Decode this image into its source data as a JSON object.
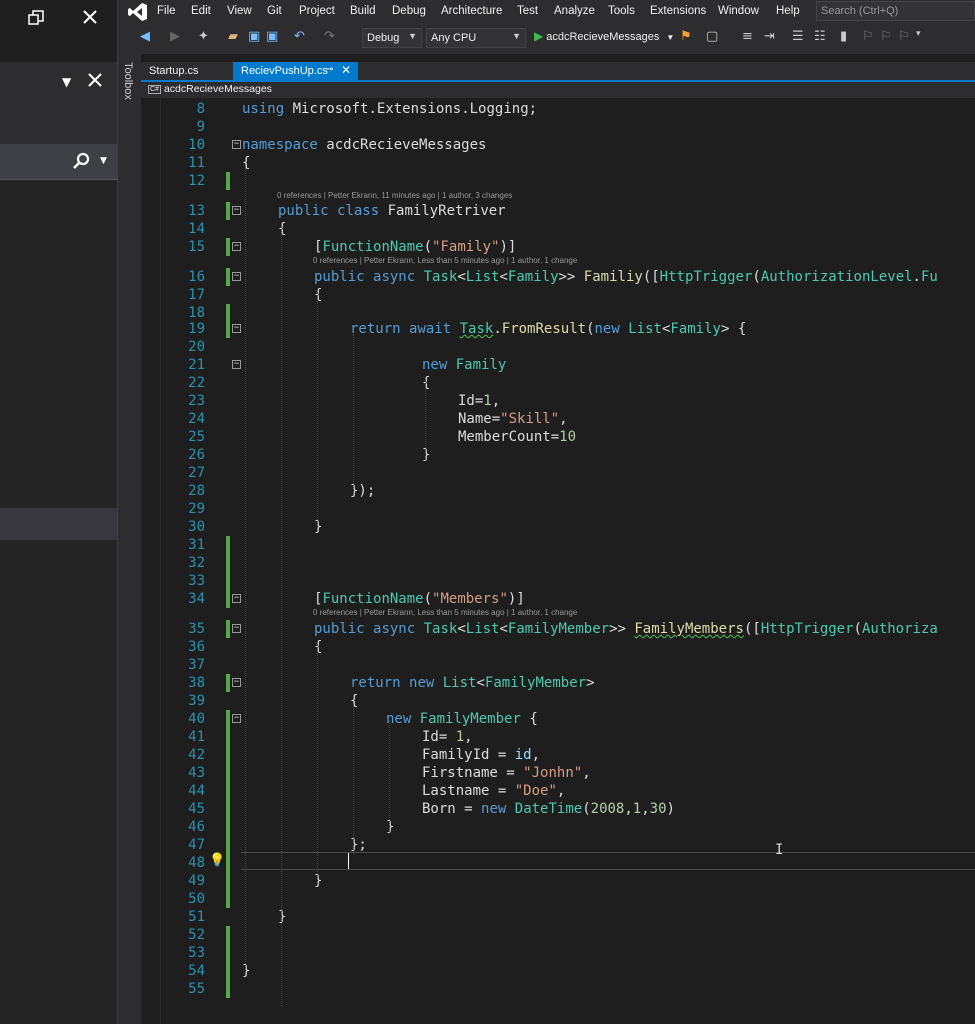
{
  "menu": {
    "items": [
      "File",
      "Edit",
      "View",
      "Git",
      "Project",
      "Build",
      "Debug",
      "Architecture",
      "Test",
      "Analyze",
      "Tools",
      "Extensions",
      "Window",
      "Help"
    ],
    "search_placeholder": "Search (Ctrl+Q)"
  },
  "toolbar": {
    "config": "Debug",
    "platform": "Any CPU",
    "run_target": "acdcRecieveMessages"
  },
  "toolbox_label": "Toolbox",
  "tabs": [
    {
      "label": "Startup.cs",
      "active": false
    },
    {
      "label": "RecievPushUp.cs",
      "active": true
    }
  ],
  "navbar": {
    "project": "acdcRecieveMessages"
  },
  "code_lens": {
    "class": "0 references | Petter Ekrann, 11 minutes ago | 1 author, 3 changes",
    "familiy": "0 references | Petter Ekrann, Less than 5 minutes ago | 1 author, 1 change",
    "members": "0 references | Petter Ekrann, Less than 5 minutes ago | 1 author, 1 change"
  },
  "code_lines": [
    {
      "n": "8",
      "code": "using Microsoft.Extensions.Logging;"
    },
    {
      "n": "9",
      "code": ""
    },
    {
      "n": "10",
      "code": "namespace acdcRecieveMessages"
    },
    {
      "n": "11",
      "code": "{"
    },
    {
      "n": "12",
      "code": ""
    },
    {
      "n": "13",
      "code": "public class FamilyRetriver"
    },
    {
      "n": "14",
      "code": "{"
    },
    {
      "n": "15",
      "code": "[FunctionName(\"Family\")]"
    },
    {
      "n": "16",
      "code": "public async Task<List<Family>> Familiy([HttpTrigger(AuthorizationLevel.Fu"
    },
    {
      "n": "17",
      "code": "{"
    },
    {
      "n": "18",
      "code": ""
    },
    {
      "n": "19",
      "code": "return await Task.FromResult(new List<Family> {"
    },
    {
      "n": "20",
      "code": ""
    },
    {
      "n": "21",
      "code": "new Family"
    },
    {
      "n": "22",
      "code": "{"
    },
    {
      "n": "23",
      "code": "Id=1,"
    },
    {
      "n": "24",
      "code": "Name=\"Skill\","
    },
    {
      "n": "25",
      "code": "MemberCount=10"
    },
    {
      "n": "26",
      "code": "}"
    },
    {
      "n": "27",
      "code": ""
    },
    {
      "n": "28",
      "code": "});"
    },
    {
      "n": "29",
      "code": ""
    },
    {
      "n": "30",
      "code": "}"
    },
    {
      "n": "31",
      "code": ""
    },
    {
      "n": "32",
      "code": ""
    },
    {
      "n": "33",
      "code": ""
    },
    {
      "n": "34",
      "code": "[FunctionName(\"Members\")]"
    },
    {
      "n": "35",
      "code": "public async Task<List<FamilyMember>> FamilyMembers([HttpTrigger(Authoriza"
    },
    {
      "n": "36",
      "code": "{"
    },
    {
      "n": "37",
      "code": ""
    },
    {
      "n": "38",
      "code": "return new List<FamilyMember>"
    },
    {
      "n": "39",
      "code": "{"
    },
    {
      "n": "40",
      "code": "new FamilyMember {"
    },
    {
      "n": "41",
      "code": "Id= 1,"
    },
    {
      "n": "42",
      "code": "FamilyId = id,"
    },
    {
      "n": "43",
      "code": "Firstname = \"Jonhn\","
    },
    {
      "n": "44",
      "code": "Lastname = \"Doe\","
    },
    {
      "n": "45",
      "code": "Born = new DateTime(2008,1,30)"
    },
    {
      "n": "46",
      "code": "}"
    },
    {
      "n": "47",
      "code": "};"
    },
    {
      "n": "48",
      "code": ""
    },
    {
      "n": "49",
      "code": "}"
    },
    {
      "n": "50",
      "code": ""
    },
    {
      "n": "51",
      "code": "}"
    },
    {
      "n": "52",
      "code": ""
    },
    {
      "n": "53",
      "code": ""
    },
    {
      "n": "54",
      "code": "}"
    },
    {
      "n": "55",
      "code": ""
    }
  ],
  "colors": {
    "keyword": "#569cd6",
    "type": "#4ec9b0",
    "string": "#d69d85",
    "number": "#b5cea8",
    "line_number": "#2b91af",
    "accent": "#007acc",
    "change_bar": "#57a64a"
  }
}
